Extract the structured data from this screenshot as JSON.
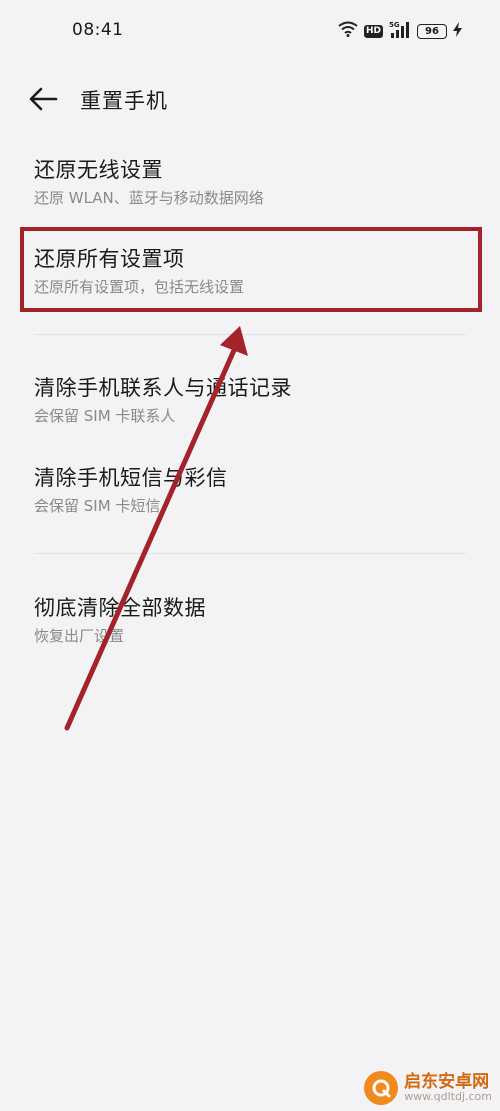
{
  "status_bar": {
    "time": "08:41",
    "hd_badge": "HD",
    "battery_level": "96",
    "icons": [
      "wifi-icon",
      "hd-icon",
      "signal-5g-icon",
      "battery-icon",
      "charging-icon"
    ]
  },
  "header": {
    "back_icon": "arrow-left-icon",
    "title": "重置手机"
  },
  "items": [
    {
      "title": "还原无线设置",
      "subtitle": "还原 WLAN、蓝牙与移动数据网络"
    },
    {
      "title": "还原所有设置项",
      "subtitle": "还原所有设置项，包括无线设置"
    },
    {
      "title": "清除手机联系人与通话记录",
      "subtitle": "会保留 SIM 卡联系人"
    },
    {
      "title": "清除手机短信与彩信",
      "subtitle": "会保留 SIM 卡短信"
    },
    {
      "title": "彻底清除全部数据",
      "subtitle": "恢复出厂设置"
    }
  ],
  "annotation": {
    "color": "#a3232a"
  },
  "watermark": {
    "name": "启东安卓网",
    "url": "www.qdltdj.com"
  }
}
